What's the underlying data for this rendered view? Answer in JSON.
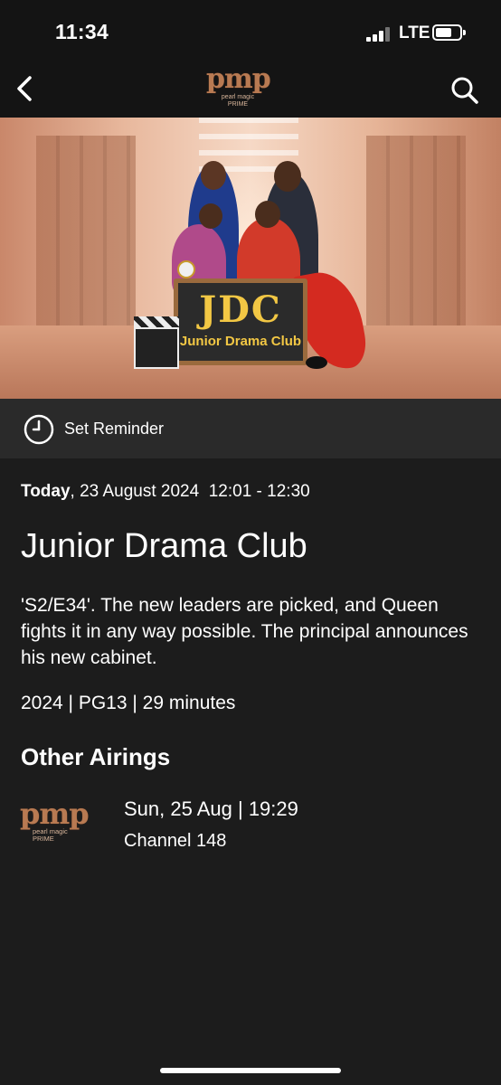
{
  "status_bar": {
    "time": "11:34",
    "network": "LTE",
    "signal_bars": 4,
    "battery_level": 0.6
  },
  "nav": {
    "back_icon": "chevron-left-icon",
    "search_icon": "search-icon",
    "logo": {
      "letters": "pmp",
      "line1": "pearl magic",
      "line2": "PRIME"
    }
  },
  "hero": {
    "board_title": "JDC",
    "board_subtitle": "Junior Drama Club"
  },
  "reminder": {
    "icon": "clock-icon",
    "label": "Set Reminder"
  },
  "program": {
    "day_label": "Today",
    "date_time": ", 23 August 2024  12:01 - 12:30",
    "title": "Junior Drama Club",
    "synopsis": "'S2/E34'. The new leaders are picked, and Queen fights it in any way possible. The principal announces his new cabinet.",
    "meta": "2024 | PG13 | 29 minutes"
  },
  "other_airings": {
    "heading": "Other Airings",
    "items": [
      {
        "logo_letters": "pmp",
        "logo_line1": "pearl magic",
        "logo_line2": "PRIME",
        "time": "Sun, 25 Aug | 19:29",
        "channel": "Channel 148"
      }
    ]
  },
  "colors": {
    "background": "#1c1c1c",
    "bar": "#141414",
    "reminder_bar": "#2a2a2a",
    "brand_copper": "#b87a52"
  }
}
